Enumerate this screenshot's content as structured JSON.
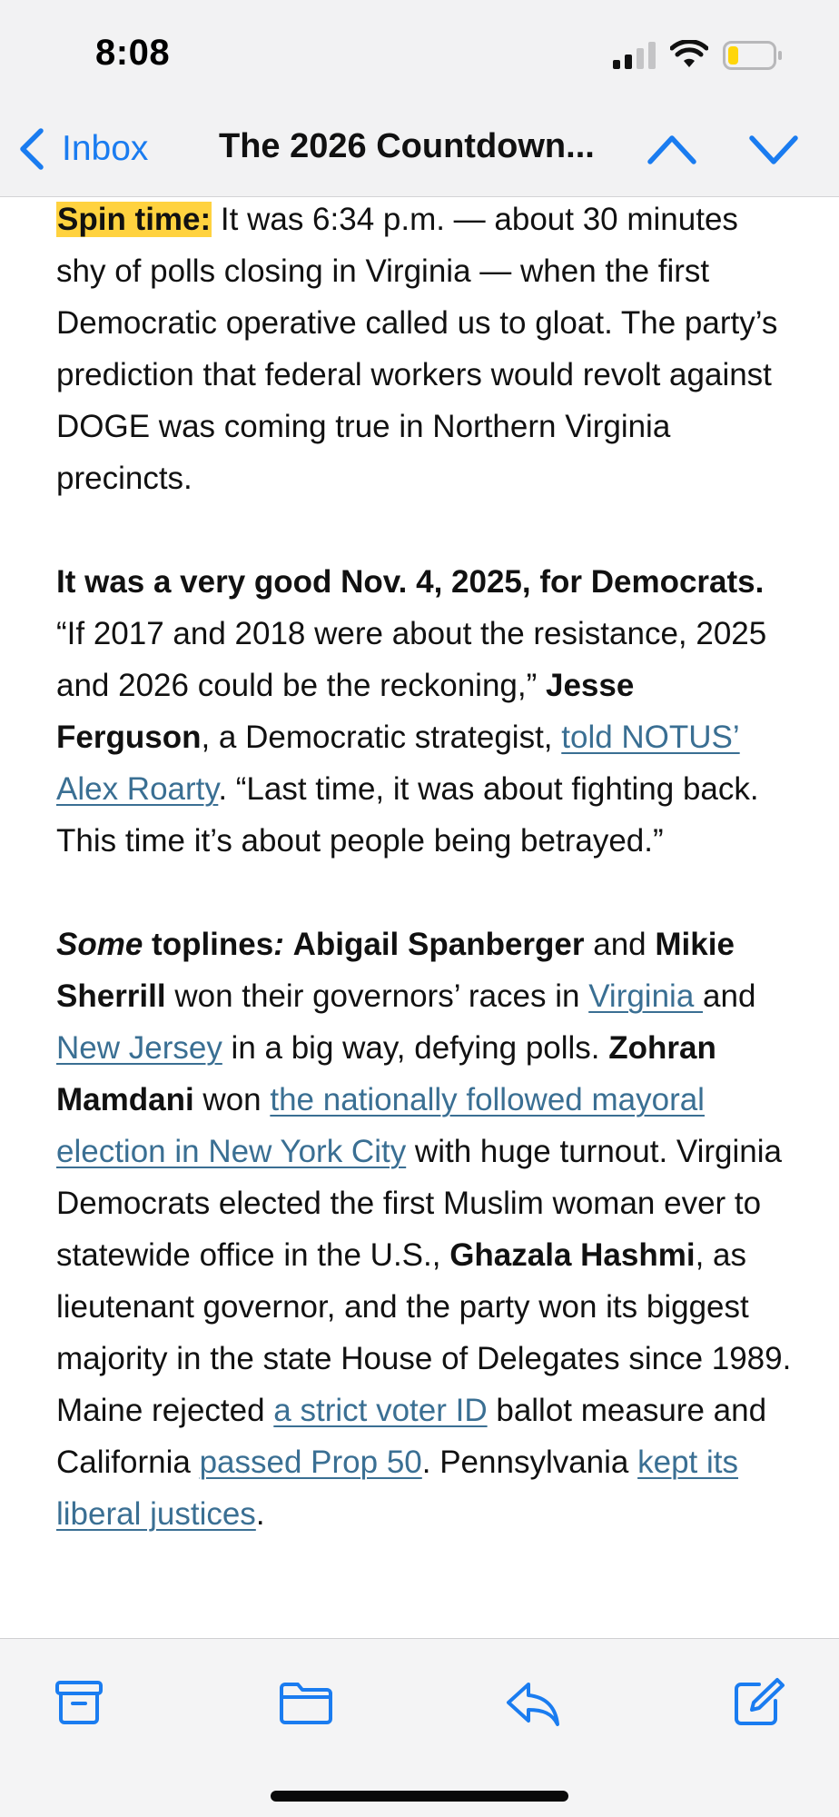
{
  "status_bar": {
    "time": "8:08"
  },
  "nav": {
    "back_label": "Inbox",
    "title": "The 2026 Countdown..."
  },
  "email": {
    "p1": {
      "label": "Spin time:",
      "text": " It was 6:34 p.m. — about 30 minutes shy of polls closing in Virginia — when the first Democratic operative called us to gloat. The party’s prediction that federal workers would revolt against DOGE was coming true in Northern Virginia precincts."
    },
    "p2": {
      "lead": "It was a very good Nov. 4, 2025, for Democrats.",
      "t1": " “If 2017 and 2018 were about the resistance, 2025 and 2026 could be the reckoning,” ",
      "name": "Jesse Ferguson",
      "t2": ", a Democratic strategist, ",
      "link": "told NOTUS’ Alex Roarty",
      "t3": ". “Last time, it was about fighting back. This time it’s about people being betrayed.”"
    },
    "p3": {
      "some": "Some",
      "toplines": " toplines",
      "colon": ":",
      "t0": " ",
      "name1": "Abigail Spanberger",
      "t1": " and ",
      "name2": "Mikie Sherrill",
      "t2": " won their governors’ races in ",
      "link1": "Virginia ",
      "t3": "and ",
      "link2": "New Jersey",
      "t4": " in a big way, defying polls. ",
      "name3": "Zohran Mamdani",
      "t5": " won ",
      "link3": "the nationally followed mayoral election in New York City",
      "t6": " with huge turnout. Virginia Democrats elected the first Muslim woman ever to statewide office in the U.S., ",
      "name4": "Ghazala Hashmi",
      "t7": ", as lieutenant governor, and the party won its biggest majority in the state House of Delegates since 1989. Maine rejected ",
      "link4": "a strict voter ID",
      "t8": " ballot measure and California ",
      "link5": "passed Prop 50",
      "t9": ". Pennsylvania ",
      "link6": "kept its liberal justices",
      "t10": "."
    }
  },
  "toolbar": {
    "icons": [
      "archive-icon",
      "folder-icon",
      "reply-icon",
      "compose-icon"
    ]
  },
  "colors": {
    "accent": "#1a7cf0",
    "link": "#3a6f93",
    "highlight": "#ffd23f",
    "battery_level": "#ffd60a"
  },
  "battery": {
    "level": 0.2
  }
}
